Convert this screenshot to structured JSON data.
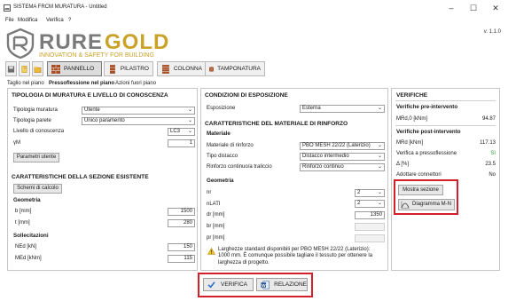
{
  "window": {
    "title": "SISTEMA FRCM MURATURA - Untitled"
  },
  "menu": [
    "File",
    "Modifica",
    "Verifica",
    "?"
  ],
  "logo": {
    "wordmark": "RUREGOLD",
    "tagline": "INNOVATION & SAFETY FOR BUILDING"
  },
  "version": "v. 1.1.0",
  "toolbar": {
    "tabs": [
      "PANNELLO",
      "PILASTRO",
      "COLONNA",
      "TAMPONATURA"
    ],
    "active": "PANNELLO"
  },
  "subtabs": [
    "Taglio nel piano",
    "Pressoflessione nel piano",
    "Azioni fuori piano"
  ],
  "left": {
    "title": "TIPOLOGIA DI MURATURA E LIVELLO DI CONOSCENZA",
    "tipologia_muratura_label": "Tipologia muratura",
    "tipologia_muratura_value": "Utente",
    "tipologia_parete_label": "Tipologia parete",
    "tipologia_parete_value": "Unico paramento",
    "livello_label": "Livello di conoscenza",
    "livello_value": "LC3",
    "ym_label": "γM",
    "ym_value": "1",
    "parametri_button": "Parametri utente",
    "sezione_title": "CARATTERISTICHE DELLA SEZIONE ESISTENTE",
    "schemi_button": "Schemi di calcolo",
    "geometria_title": "Geometria",
    "b_label": "b [mm]",
    "b_value": "1500",
    "t_label": "t [mm]",
    "t_value": "280",
    "sollecitazioni_title": "Sollecitazioni",
    "ned_label": "NEd [kN]",
    "ned_value": "150",
    "med_label": "MEd [kNm]",
    "med_value": "115"
  },
  "middle": {
    "title": "CONDIZIONI DI ESPOSIZIONE",
    "esposizione_label": "Esposizione",
    "esposizione_value": "Esterna",
    "rinforzo_title": "CARATTERISTICHE DEL MATERIALE DI RINFORZO",
    "materiale_title": "Materiale",
    "materiale_label": "Materiale di rinforzo",
    "materiale_value": "PBO MESH 22/22 (Laterizio)",
    "distacco_label": "Tipo distacco",
    "distacco_value": "Distacco intermedio",
    "continuo_label": "Rinforzo continuo/a traliccio",
    "continuo_value": "Rinforzo continuo",
    "geometria_title": "Geometria",
    "nr_label": "nr",
    "nr_value": "2",
    "nlati_label": "nLATI",
    "nlati_value": "2",
    "dr_label": "dr [mm]",
    "dr_value": "1350",
    "br_label": "br [mm]",
    "pr_label": "pr [mm]",
    "warning": "Larghezze standard disponibili per PBO MESH 22/22 (Laterizio): 1000 mm. È comunque possibile tagliare il tessuto per ottenere la larghezza di progetto."
  },
  "right": {
    "title": "VERIFICHE",
    "pre_title": "Verifiche pre-intervento",
    "mrd0_label": "MRd,0 [kNm]",
    "mrd0_value": "94.87",
    "post_title": "Verifiche post-intervento",
    "mrd_label": "MRd [kNm]",
    "mrd_value": "117.13",
    "verifica_label": "Verifica a pressoflessione",
    "verifica_value": "Sì",
    "delta_label": "Δ [%]",
    "delta_value": "23.5",
    "adottare_label": "Adottare connettori",
    "adottare_value": "No",
    "mostra_button": "Mostra sezione",
    "diagramma_button": "Diagramma M-N"
  },
  "bottom": {
    "verifica_button": "VERIFICA",
    "relazione_button": "RELAZIONE"
  },
  "colors": {
    "highlight": "#d21f2a",
    "logo_gray": "#7a7a7a",
    "logo_gold": "#c9a227"
  }
}
